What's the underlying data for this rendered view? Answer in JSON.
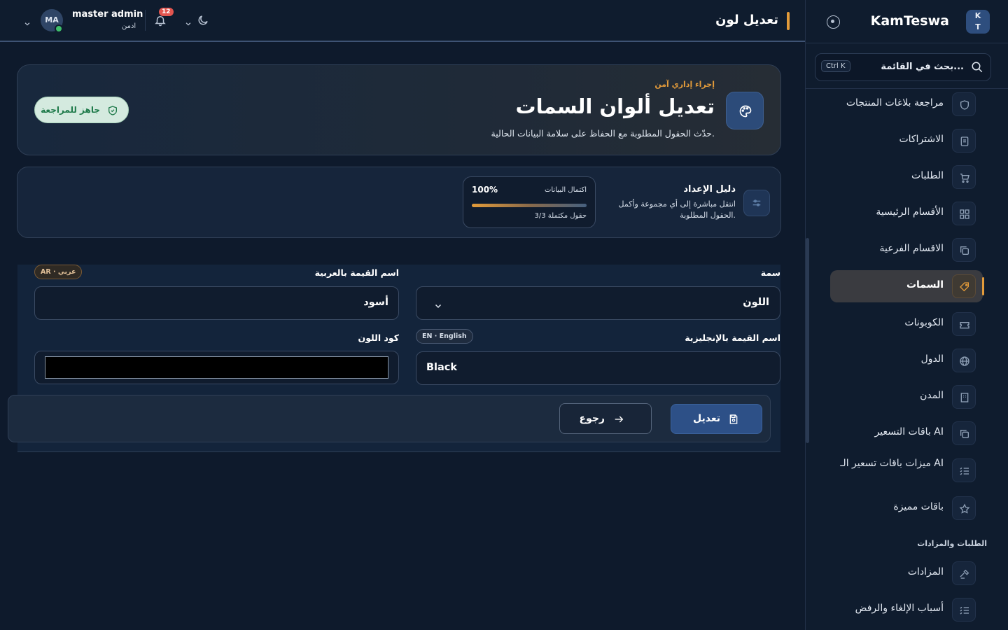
{
  "brand": {
    "name": "KamTeswa",
    "badge": "K\nT"
  },
  "search": {
    "placeholder": "بحث في القائمة...",
    "shortcut": "Ctrl K"
  },
  "sidebar": {
    "items": [
      {
        "label": "مراجعة بلاغات المنتجات",
        "icon": "shield-icon"
      },
      {
        "label": "الاشتراكات",
        "icon": "document-icon"
      },
      {
        "label": "الطلبات",
        "icon": "cart-icon"
      },
      {
        "label": "الأقسام الرئيسية",
        "icon": "grid-icon"
      },
      {
        "label": "الاقسام الفرعية",
        "icon": "copy-icon"
      },
      {
        "label": "السمات",
        "icon": "tag-icon",
        "active": true
      },
      {
        "label": "الكوبونات",
        "icon": "ticket-icon"
      },
      {
        "label": "الدول",
        "icon": "globe-icon"
      },
      {
        "label": "المدن",
        "icon": "building-icon"
      },
      {
        "label": "باقات التسعير AI",
        "icon": "copy-icon"
      },
      {
        "label": "ميزات باقات تسعير الـ AI",
        "icon": "list-icon"
      },
      {
        "label": "باقات مميزة",
        "icon": "star-icon"
      },
      {
        "label": "المزادات",
        "icon": "gavel-icon"
      },
      {
        "label": "أسباب الإلغاء والرفض",
        "icon": "list-icon"
      }
    ],
    "section_orders": "الطلبات والمزادات"
  },
  "topbar": {
    "title": "تعديل لون",
    "user_name": "master admin",
    "user_role": "ادمن",
    "avatar_initials": "MA",
    "notifications_count": "12"
  },
  "hero": {
    "eyebrow": "إجراء إداري آمن",
    "title": "تعديل ألوان السمات",
    "subtitle": "حدّث الحقول المطلوبة مع الحفاظ على سلامة البيانات الحالية.",
    "status": "جاهز للمراجعة"
  },
  "guide": {
    "title": "دليل الإعداد",
    "description": "انتقل مباشرة إلى أي مجموعة وأكمل الحقول المطلوبة.",
    "progress_label": "اكتمال البيانات",
    "progress_value": "100%",
    "progress_fraction": 1.0,
    "progress_count": "3/3 حقول مكتملة"
  },
  "form": {
    "attribute_label": "سمة",
    "attribute_value": "اللون",
    "name_ar_label": "اسم القيمة بالعربية",
    "name_ar_tag": "AR · عربي",
    "name_ar_value": "أسود",
    "name_en_label": "اسم القيمة بالإنجليزية",
    "name_en_tag": "EN · English",
    "name_en_value": "Black",
    "color_code_label": "كود اللون",
    "color_value": "#000000"
  },
  "actions": {
    "save": "تعديل",
    "back": "رجوع"
  },
  "colors": {
    "accent": "#e39b3a",
    "primary": "#2d5087",
    "background": "#0e1a2c",
    "success": "#1e7a4a"
  }
}
